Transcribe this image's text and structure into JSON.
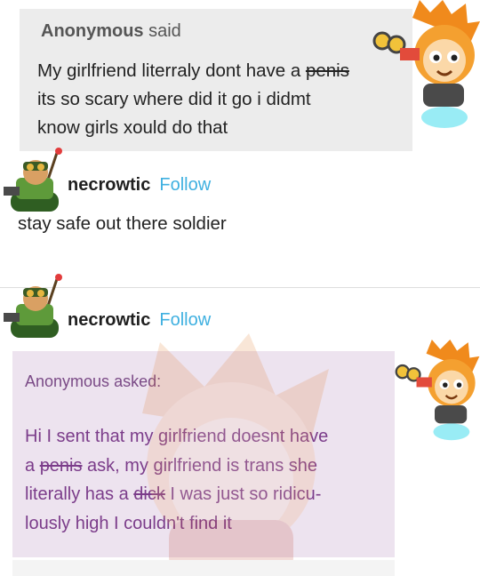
{
  "post1": {
    "ask": {
      "author": "Anonymous",
      "said": " said",
      "line1_before": "My girlfriend literraly dont have a ",
      "line1_struck": "penis",
      "line2": "its so scary where did it go i didmt",
      "line3": "know girls xould do that"
    },
    "reply": {
      "username": "necrowtic",
      "follow_label": "Follow",
      "text": "stay safe out there soldier"
    }
  },
  "post2": {
    "username": "necrowtic",
    "follow_label": "Follow",
    "ask": {
      "author": "Anonymous",
      "asked": " asked:",
      "line1": "Hi I sent that my girlfriend doesnt have",
      "line2_a": "a ",
      "line2_struck": "penis",
      "line2_b": " ask, my girlfriend is trans she",
      "line3_a": "literally has a ",
      "line3_struck": "dick",
      "line3_b": " I was just so ridicu-",
      "line4": "lously high I couldn't find it"
    }
  },
  "colors": {
    "follow": "#3fb0e0",
    "ask_box_gray": "#ececec",
    "ask_box_purple": "#ede3ef",
    "purple_text": "#7b3c8a"
  },
  "icons": [
    "monkey-sticker-icon",
    "tank-avatar-icon"
  ]
}
